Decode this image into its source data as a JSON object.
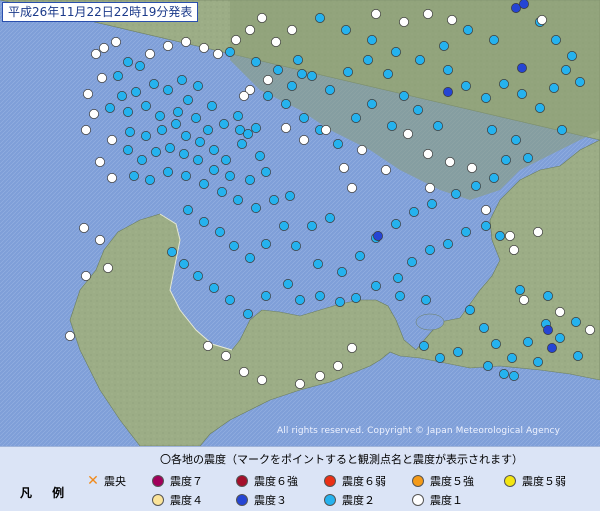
{
  "title": "平成26年11月22日22時19分発表",
  "copyright": "All rights reserved. Copyright © Japan Meteorological Agency",
  "legend": {
    "title": "〇各地の震度（マークをポイントすると観測点名と震度が表示されます）",
    "heading": "凡 例",
    "items": [
      {
        "label": "震央",
        "kind": "epicenter",
        "color": "#f08a1c"
      },
      {
        "label": "震度７",
        "kind": "dot",
        "color": "#a1005a"
      },
      {
        "label": "震度６強",
        "kind": "dot",
        "color": "#a30f2b"
      },
      {
        "label": "震度６弱",
        "kind": "dot",
        "color": "#ea3016"
      },
      {
        "label": "震度５強",
        "kind": "dot",
        "color": "#f49a18"
      },
      {
        "label": "震度５弱",
        "kind": "dot",
        "color": "#f3e512"
      },
      {
        "label": "震度４",
        "kind": "dot",
        "color": "#fbe49a"
      },
      {
        "label": "震度３",
        "kind": "dot",
        "color": "#2545d4"
      },
      {
        "label": "震度２",
        "kind": "dot",
        "color": "#25b2ee"
      },
      {
        "label": "震度１",
        "kind": "dot",
        "color": "#ffffff"
      }
    ]
  },
  "colors": {
    "land": "#9cad86",
    "sea": "#7f9fd8",
    "dot1": "#ffffff",
    "dot2": "#25b2ee",
    "dot3": "#2545d4"
  }
}
